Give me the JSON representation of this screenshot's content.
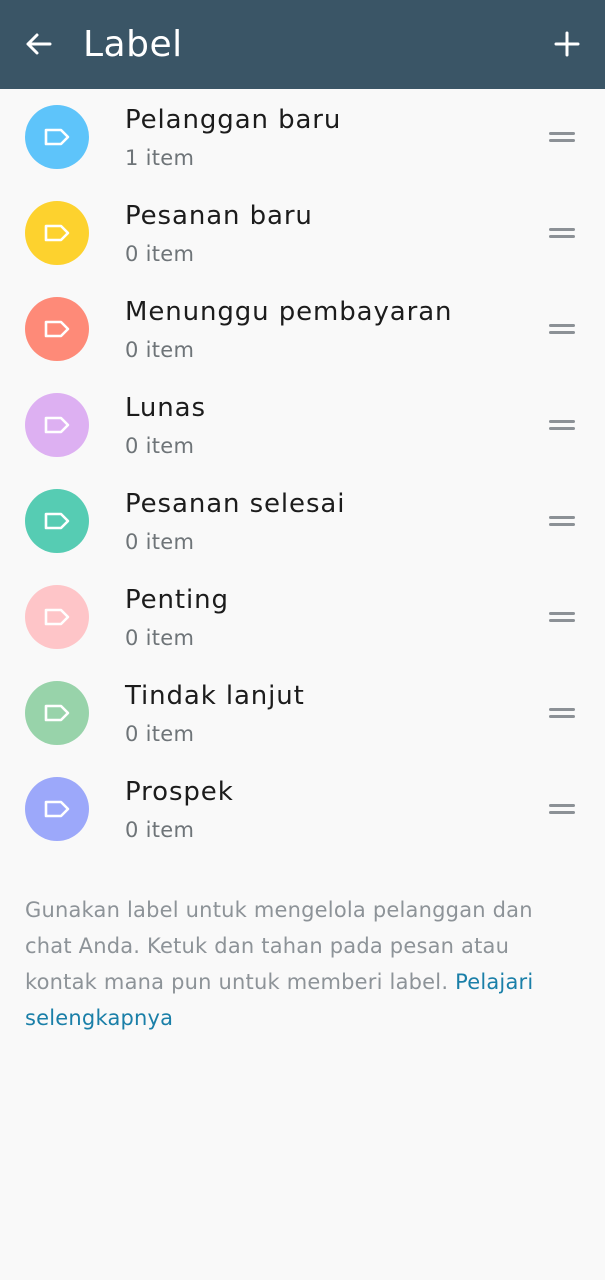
{
  "appbar": {
    "title": "Label",
    "back_icon": "arrow-back-icon",
    "add_icon": "plus-icon",
    "background": "#3a5566"
  },
  "labels": [
    {
      "name": "Pelanggan baru",
      "count": "1 item",
      "color": "#5ec4fa"
    },
    {
      "name": "Pesanan baru",
      "count": "0 item",
      "color": "#fdd22e"
    },
    {
      "name": "Menunggu pembayaran",
      "count": "0 item",
      "color": "#fe8a78"
    },
    {
      "name": "Lunas",
      "count": "0 item",
      "color": "#ddb0f2"
    },
    {
      "name": "Pesanan selesai",
      "count": "0 item",
      "color": "#56ccb3"
    },
    {
      "name": "Penting",
      "count": "0 item",
      "color": "#fec5c8"
    },
    {
      "name": "Tindak lanjut",
      "count": "0 item",
      "color": "#98d3aa"
    },
    {
      "name": "Prospek",
      "count": "0 item",
      "color": "#9ca8fa"
    }
  ],
  "footer": {
    "text": "Gunakan label untuk mengelola pelanggan dan chat Anda. Ketuk dan tahan pada pesan atau kontak mana pun untuk memberi label.",
    "link": "Pelajari selengkapnya",
    "link_color": "#1a7fa8"
  }
}
